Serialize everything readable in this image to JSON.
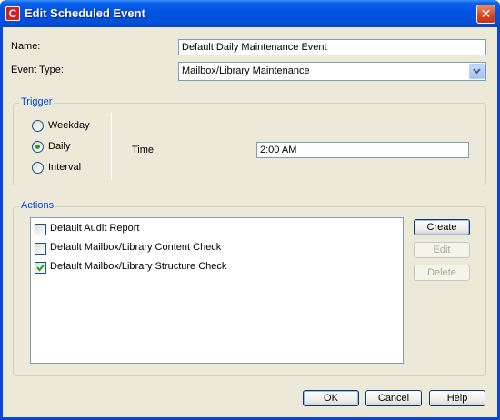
{
  "window": {
    "title": "Edit Scheduled Event",
    "app_icon_text": "C",
    "close_glyph": "✕"
  },
  "form": {
    "name_label": "Name:",
    "name_value": "Default Daily Maintenance Event",
    "event_type_label": "Event Type:",
    "event_type_value": "Mailbox/Library Maintenance"
  },
  "trigger": {
    "title": "Trigger",
    "options": [
      {
        "label": "Weekday",
        "selected": false
      },
      {
        "label": "Daily",
        "selected": true
      },
      {
        "label": "Interval",
        "selected": false
      }
    ],
    "time_label": "Time:",
    "time_value": "2:00 AM"
  },
  "actions": {
    "title": "Actions",
    "items": [
      {
        "label": "Default Audit Report",
        "checked": false
      },
      {
        "label": "Default Mailbox/Library Content Check",
        "checked": false
      },
      {
        "label": "Default Mailbox/Library Structure Check",
        "checked": true
      }
    ],
    "create_label": "Create",
    "edit_label": "Edit",
    "delete_label": "Delete"
  },
  "footer": {
    "ok_label": "OK",
    "cancel_label": "Cancel",
    "help_label": "Help"
  },
  "colors": {
    "title_blue": "#0053e0",
    "group_title": "#0046d5",
    "dialog_bg": "#ece9d8",
    "check_green": "#21a121"
  }
}
